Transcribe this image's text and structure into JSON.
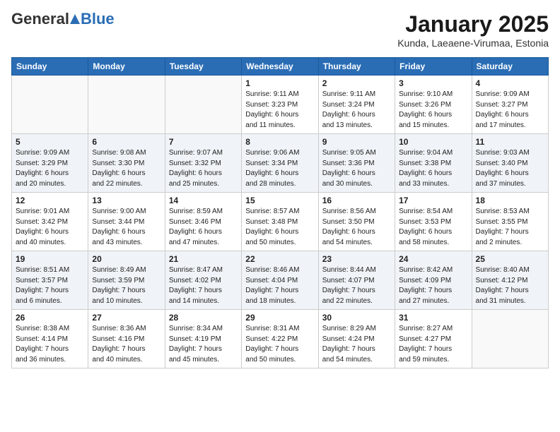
{
  "header": {
    "logo_general": "General",
    "logo_blue": "Blue",
    "month_title": "January 2025",
    "location": "Kunda, Laeaene-Virumaa, Estonia"
  },
  "days_of_week": [
    "Sunday",
    "Monday",
    "Tuesday",
    "Wednesday",
    "Thursday",
    "Friday",
    "Saturday"
  ],
  "weeks": [
    [
      {
        "day": "",
        "info": ""
      },
      {
        "day": "",
        "info": ""
      },
      {
        "day": "",
        "info": ""
      },
      {
        "day": "1",
        "info": "Sunrise: 9:11 AM\nSunset: 3:23 PM\nDaylight: 6 hours\nand 11 minutes."
      },
      {
        "day": "2",
        "info": "Sunrise: 9:11 AM\nSunset: 3:24 PM\nDaylight: 6 hours\nand 13 minutes."
      },
      {
        "day": "3",
        "info": "Sunrise: 9:10 AM\nSunset: 3:26 PM\nDaylight: 6 hours\nand 15 minutes."
      },
      {
        "day": "4",
        "info": "Sunrise: 9:09 AM\nSunset: 3:27 PM\nDaylight: 6 hours\nand 17 minutes."
      }
    ],
    [
      {
        "day": "5",
        "info": "Sunrise: 9:09 AM\nSunset: 3:29 PM\nDaylight: 6 hours\nand 20 minutes."
      },
      {
        "day": "6",
        "info": "Sunrise: 9:08 AM\nSunset: 3:30 PM\nDaylight: 6 hours\nand 22 minutes."
      },
      {
        "day": "7",
        "info": "Sunrise: 9:07 AM\nSunset: 3:32 PM\nDaylight: 6 hours\nand 25 minutes."
      },
      {
        "day": "8",
        "info": "Sunrise: 9:06 AM\nSunset: 3:34 PM\nDaylight: 6 hours\nand 28 minutes."
      },
      {
        "day": "9",
        "info": "Sunrise: 9:05 AM\nSunset: 3:36 PM\nDaylight: 6 hours\nand 30 minutes."
      },
      {
        "day": "10",
        "info": "Sunrise: 9:04 AM\nSunset: 3:38 PM\nDaylight: 6 hours\nand 33 minutes."
      },
      {
        "day": "11",
        "info": "Sunrise: 9:03 AM\nSunset: 3:40 PM\nDaylight: 6 hours\nand 37 minutes."
      }
    ],
    [
      {
        "day": "12",
        "info": "Sunrise: 9:01 AM\nSunset: 3:42 PM\nDaylight: 6 hours\nand 40 minutes."
      },
      {
        "day": "13",
        "info": "Sunrise: 9:00 AM\nSunset: 3:44 PM\nDaylight: 6 hours\nand 43 minutes."
      },
      {
        "day": "14",
        "info": "Sunrise: 8:59 AM\nSunset: 3:46 PM\nDaylight: 6 hours\nand 47 minutes."
      },
      {
        "day": "15",
        "info": "Sunrise: 8:57 AM\nSunset: 3:48 PM\nDaylight: 6 hours\nand 50 minutes."
      },
      {
        "day": "16",
        "info": "Sunrise: 8:56 AM\nSunset: 3:50 PM\nDaylight: 6 hours\nand 54 minutes."
      },
      {
        "day": "17",
        "info": "Sunrise: 8:54 AM\nSunset: 3:53 PM\nDaylight: 6 hours\nand 58 minutes."
      },
      {
        "day": "18",
        "info": "Sunrise: 8:53 AM\nSunset: 3:55 PM\nDaylight: 7 hours\nand 2 minutes."
      }
    ],
    [
      {
        "day": "19",
        "info": "Sunrise: 8:51 AM\nSunset: 3:57 PM\nDaylight: 7 hours\nand 6 minutes."
      },
      {
        "day": "20",
        "info": "Sunrise: 8:49 AM\nSunset: 3:59 PM\nDaylight: 7 hours\nand 10 minutes."
      },
      {
        "day": "21",
        "info": "Sunrise: 8:47 AM\nSunset: 4:02 PM\nDaylight: 7 hours\nand 14 minutes."
      },
      {
        "day": "22",
        "info": "Sunrise: 8:46 AM\nSunset: 4:04 PM\nDaylight: 7 hours\nand 18 minutes."
      },
      {
        "day": "23",
        "info": "Sunrise: 8:44 AM\nSunset: 4:07 PM\nDaylight: 7 hours\nand 22 minutes."
      },
      {
        "day": "24",
        "info": "Sunrise: 8:42 AM\nSunset: 4:09 PM\nDaylight: 7 hours\nand 27 minutes."
      },
      {
        "day": "25",
        "info": "Sunrise: 8:40 AM\nSunset: 4:12 PM\nDaylight: 7 hours\nand 31 minutes."
      }
    ],
    [
      {
        "day": "26",
        "info": "Sunrise: 8:38 AM\nSunset: 4:14 PM\nDaylight: 7 hours\nand 36 minutes."
      },
      {
        "day": "27",
        "info": "Sunrise: 8:36 AM\nSunset: 4:16 PM\nDaylight: 7 hours\nand 40 minutes."
      },
      {
        "day": "28",
        "info": "Sunrise: 8:34 AM\nSunset: 4:19 PM\nDaylight: 7 hours\nand 45 minutes."
      },
      {
        "day": "29",
        "info": "Sunrise: 8:31 AM\nSunset: 4:22 PM\nDaylight: 7 hours\nand 50 minutes."
      },
      {
        "day": "30",
        "info": "Sunrise: 8:29 AM\nSunset: 4:24 PM\nDaylight: 7 hours\nand 54 minutes."
      },
      {
        "day": "31",
        "info": "Sunrise: 8:27 AM\nSunset: 4:27 PM\nDaylight: 7 hours\nand 59 minutes."
      },
      {
        "day": "",
        "info": ""
      }
    ]
  ]
}
